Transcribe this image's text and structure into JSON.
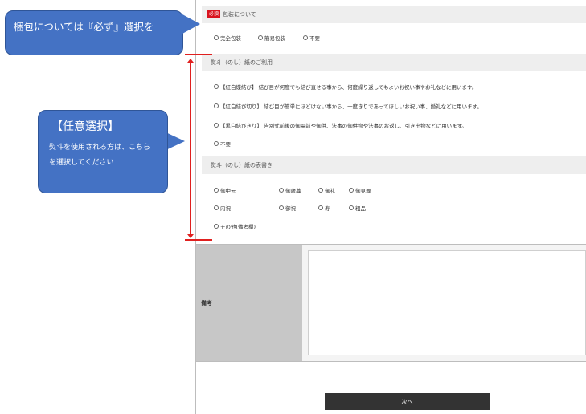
{
  "callout_wrapping": {
    "text": "梱包については『必ず』選択を"
  },
  "callout_optional": {
    "title": "【任意選択】",
    "body": "熨斗を使用される方は、こちらを選択してください"
  },
  "wrapping_section": {
    "required_badge": "必須",
    "title": "包装について",
    "options": [
      "完全包装",
      "簡易包装",
      "不要"
    ]
  },
  "noshi_usage_section": {
    "title": "熨斗（のし）紙のご利用",
    "options": [
      "【紅白蝶結び】 結び目が何度でも結び直せる事から、何度繰り返してもよいお祝い事やお礼などに用います。",
      "【紅白結び切り】 結び目が簡単にほどけない事から、一度きりであってほしいお祝い事、婚礼などに用います。",
      "【黒白結びきり】 告別式前後の御霊前や御供、法事の御供物や法事のお返し、引き出物などに用います。",
      "不要"
    ]
  },
  "noshi_inscription_section": {
    "title": "熨斗（のし）紙の表書き",
    "options_row1": [
      "御中元",
      "御歳暮",
      "御礼",
      "御見舞"
    ],
    "options_row2": [
      "内祝",
      "御祝",
      "寿",
      "粗品"
    ],
    "options_row3": [
      "その他(備考欄)"
    ]
  },
  "notes": {
    "label": "備考",
    "value": ""
  },
  "next_button": {
    "label": "次へ"
  },
  "colors": {
    "callout_bg": "#4472c4",
    "required_badge": "#d9141f",
    "marker_line": "#e0201f",
    "next_button_bg": "#333333"
  }
}
